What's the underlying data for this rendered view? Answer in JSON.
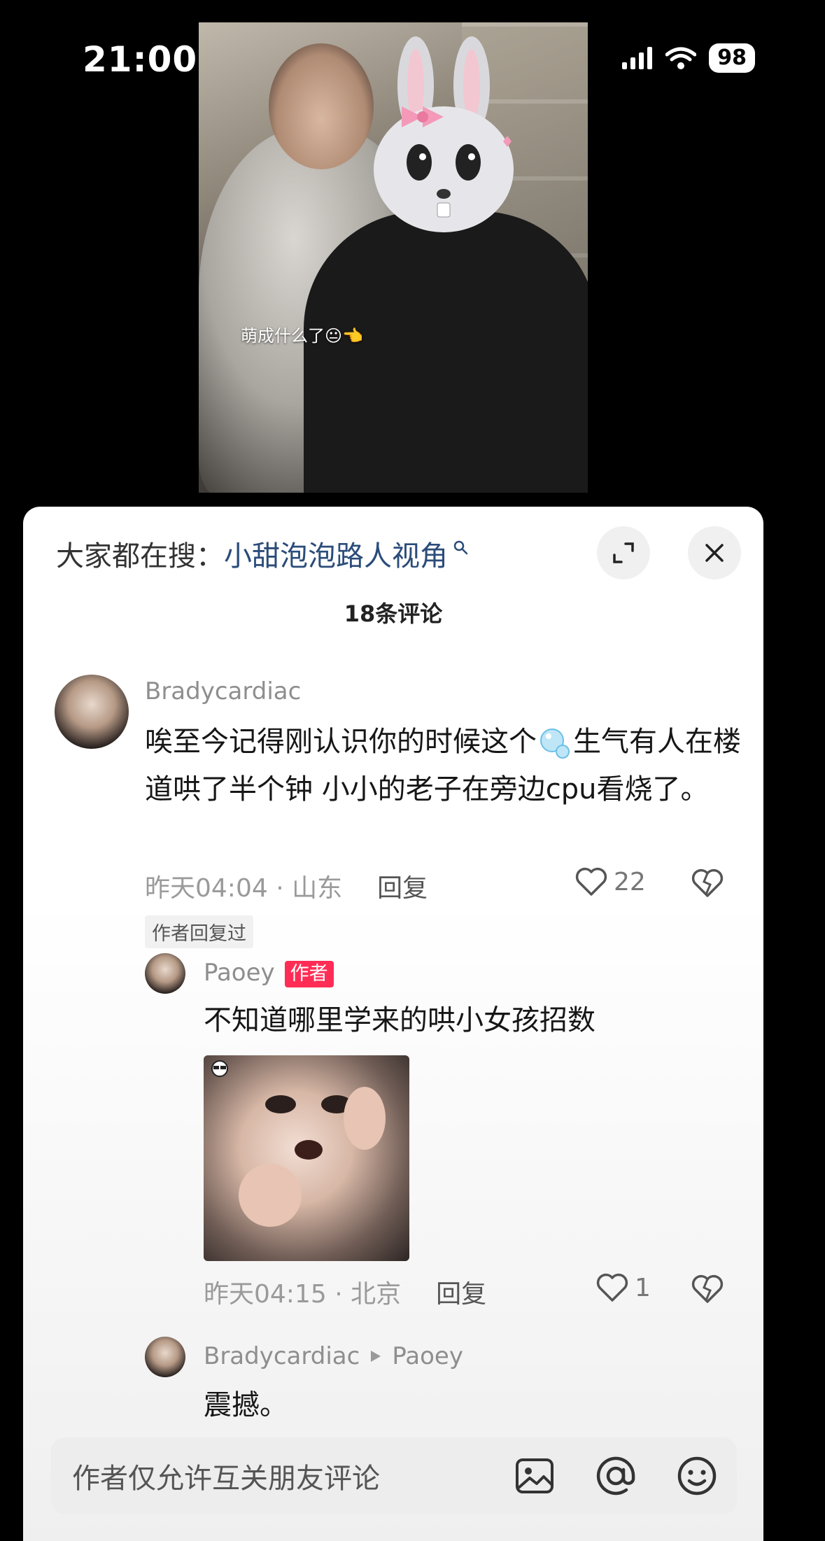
{
  "status": {
    "time": "21:00",
    "battery": "98"
  },
  "video": {
    "caption": "萌成什么了😐👈"
  },
  "sheet": {
    "search_prefix": "大家都在搜：",
    "search_term": "小甜泡泡路人视角",
    "comment_count": "18条评论"
  },
  "comments": [
    {
      "username": "Bradycardiac",
      "text_part1": "唉至今记得刚认识你的时候这个",
      "text_part2": "生气有人在楼道哄了半个钟 小小的老子在旁边cpu看烧了。",
      "time": "昨天04:04 · 山东",
      "reply": "回复",
      "likes": "22",
      "author_replied": "作者回复过"
    }
  ],
  "replies": [
    {
      "username": "Paoey",
      "badge": "作者",
      "text": "不知道哪里学来的哄小女孩招数",
      "time": "昨天04:15 · 北京",
      "reply": "回复",
      "likes": "1"
    },
    {
      "username": "Bradycardiac",
      "reply_to": "Paoey",
      "text": "震撼。"
    }
  ],
  "input": {
    "placeholder": "作者仅允许互关朋友评论"
  },
  "icons": {
    "location": "location-arrow-icon",
    "signal": "signal-icon",
    "wifi": "wifi-icon",
    "expand": "expand-icon",
    "close": "close-icon",
    "like": "heart-icon",
    "dislike": "broken-heart-icon",
    "image": "image-icon",
    "mention": "at-icon",
    "emoji": "emoji-icon",
    "bubble": "bubble-emoji-icon"
  },
  "colors": {
    "author_badge": "#ff2d55",
    "search_term": "#2b4c7a"
  }
}
